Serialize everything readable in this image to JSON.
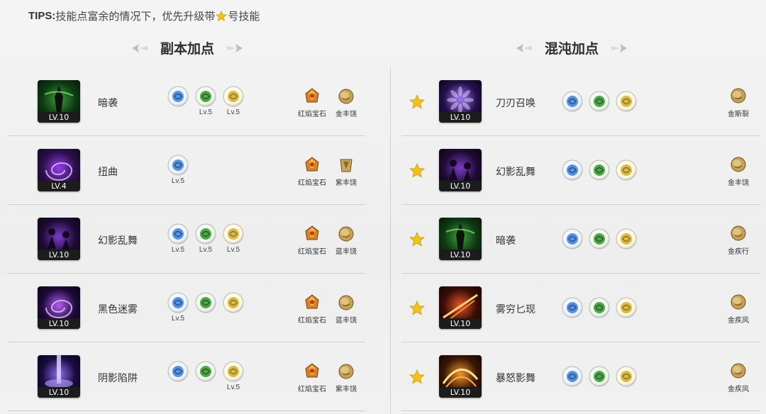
{
  "tips": {
    "prefix": "TIPS:",
    "text_before_star": "技能点富余的情况下，优先升级带",
    "text_after_star": "号技能"
  },
  "sections": {
    "left_title": "副本加点",
    "right_title": "混沌加点"
  },
  "colors": {
    "star": "#f2c21a",
    "rune_blue": "#4a86d8",
    "rune_green": "#3f9a3a",
    "rune_gold": "#d4b23a",
    "gem_orange": "#c8741c",
    "gem_brown": "#b08a3e"
  },
  "left_rows": [
    {
      "name": "暗袭",
      "level": "LV.10",
      "icon_theme": "green-shadow",
      "runes": [
        {
          "color": "blue",
          "icon": "swirl-rune-icon",
          "lv": ""
        },
        {
          "color": "green",
          "icon": "amp-rune-icon",
          "lv": "Lv.5"
        },
        {
          "color": "gold",
          "icon": "spiral-rune-icon",
          "lv": "Lv.5"
        }
      ],
      "gems": [
        {
          "type": "orange",
          "label": "红焰宝石"
        },
        {
          "type": "brown",
          "label": "金丰饶"
        }
      ]
    },
    {
      "name": "扭曲",
      "level": "LV.4",
      "icon_theme": "purple-swirl",
      "runes": [
        {
          "color": "blue",
          "icon": "orb-rune-icon",
          "lv": "Lv.5"
        }
      ],
      "gems": [
        {
          "type": "orange",
          "label": "红焰宝石"
        },
        {
          "type": "brown2",
          "label": "紫丰饶"
        }
      ]
    },
    {
      "name": "幻影乱舞",
      "level": "LV.10",
      "icon_theme": "purple-figures",
      "runes": [
        {
          "color": "blue",
          "icon": "orb-rune-icon",
          "lv": "Lv.5"
        },
        {
          "color": "green",
          "icon": "amp-rune-icon",
          "lv": "Lv.5"
        },
        {
          "color": "gold",
          "icon": "wave-rune-icon",
          "lv": "Lv.5"
        }
      ],
      "gems": [
        {
          "type": "orange",
          "label": "红焰宝石"
        },
        {
          "type": "brown",
          "label": "蓝丰饶"
        }
      ]
    },
    {
      "name": "黑色迷雾",
      "level": "LV.10",
      "icon_theme": "purple-vortex",
      "runes": [
        {
          "color": "blue",
          "icon": "figure-rune-icon",
          "lv": "Lv.5"
        },
        {
          "color": "green",
          "icon": "swirl-rune-icon",
          "lv": ""
        },
        {
          "color": "gold",
          "icon": "hand-rune-icon",
          "lv": ""
        }
      ],
      "gems": [
        {
          "type": "orange",
          "label": "红焰宝石"
        },
        {
          "type": "brown",
          "label": "蓝丰饶"
        }
      ]
    },
    {
      "name": "阴影陷阱",
      "level": "LV.10",
      "icon_theme": "purple-beam",
      "runes": [
        {
          "color": "blue",
          "icon": "arrow-rune-icon",
          "lv": ""
        },
        {
          "color": "green",
          "icon": "spiral-rune-icon",
          "lv": ""
        },
        {
          "color": "gold",
          "icon": "spiral-rune-icon",
          "lv": "Lv.5"
        }
      ],
      "gems": [
        {
          "type": "orange",
          "label": "红焰宝石"
        },
        {
          "type": "brown",
          "label": "紫丰饶"
        }
      ]
    }
  ],
  "right_rows": [
    {
      "name": "刀刃召唤",
      "level": "LV.10",
      "icon_theme": "purple-bloom",
      "runes": [
        {
          "color": "blue",
          "icon": "figure-rune-icon"
        },
        {
          "color": "green",
          "icon": "tree-rune-icon"
        },
        {
          "color": "gold",
          "icon": "eye-rune-icon"
        }
      ],
      "gem": {
        "label": "金斯裂"
      }
    },
    {
      "name": "幻影乱舞",
      "level": "LV.10",
      "icon_theme": "purple-figures",
      "runes": [
        {
          "color": "blue",
          "icon": "moon-rune-icon"
        },
        {
          "color": "green",
          "icon": "amp-rune-icon"
        },
        {
          "color": "gold",
          "icon": "cross-rune-icon"
        }
      ],
      "gem": {
        "label": "金丰饶"
      }
    },
    {
      "name": "暗袭",
      "level": "LV.10",
      "icon_theme": "green-shadow",
      "runes": [
        {
          "color": "blue",
          "icon": "swirl-rune-icon"
        },
        {
          "color": "green",
          "icon": "amp-rune-icon"
        },
        {
          "color": "gold",
          "icon": "spiral-rune-icon"
        }
      ],
      "gem": {
        "label": "金疾行"
      }
    },
    {
      "name": "雾穷匕现",
      "level": "LV.10",
      "icon_theme": "orange-slash",
      "runes": [
        {
          "color": "blue",
          "icon": "eye-rune-icon"
        },
        {
          "color": "green",
          "icon": "amp-rune-icon"
        },
        {
          "color": "gold",
          "icon": "ring-rune-icon"
        }
      ],
      "gem": {
        "label": "金疾风"
      }
    },
    {
      "name": "暴怒影舞",
      "level": "LV.10",
      "icon_theme": "orange-arcs",
      "runes": [
        {
          "color": "blue",
          "icon": "amp-rune-icon"
        },
        {
          "color": "green",
          "icon": "figure-rune-icon"
        },
        {
          "color": "gold",
          "icon": "eye-rune-icon"
        }
      ],
      "gem": {
        "label": "金疾风"
      }
    }
  ]
}
